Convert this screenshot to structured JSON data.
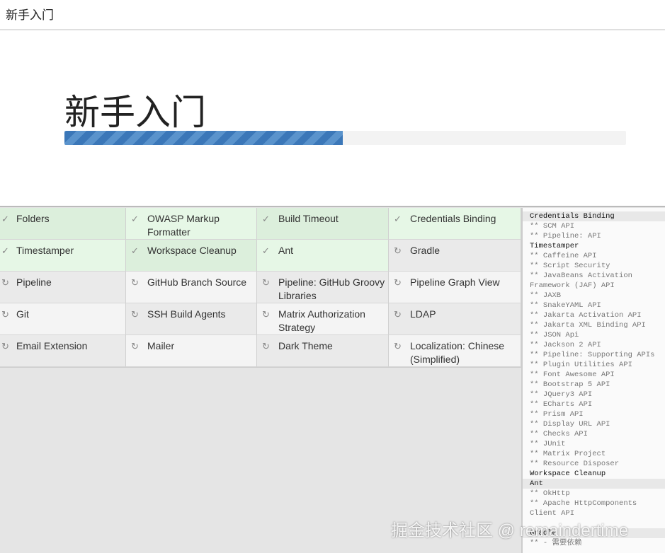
{
  "window_title": "新手入门",
  "heading": "新手入门",
  "progress_percent": 49.6,
  "plugins": [
    {
      "name": "Folders",
      "status": "installed"
    },
    {
      "name": "OWASP Markup Formatter",
      "status": "installed"
    },
    {
      "name": "Build Timeout",
      "status": "installed"
    },
    {
      "name": "Credentials Binding",
      "status": "installed"
    },
    {
      "name": "Timestamper",
      "status": "installed"
    },
    {
      "name": "Workspace Cleanup",
      "status": "installed"
    },
    {
      "name": "Ant",
      "status": "installed"
    },
    {
      "name": "Gradle",
      "status": "pending"
    },
    {
      "name": "Pipeline",
      "status": "pending"
    },
    {
      "name": "GitHub Branch Source",
      "status": "pending"
    },
    {
      "name": "Pipeline: GitHub Groovy Libraries",
      "status": "pending"
    },
    {
      "name": "Pipeline Graph View",
      "status": "pending"
    },
    {
      "name": "Git",
      "status": "pending"
    },
    {
      "name": "SSH Build Agents",
      "status": "pending"
    },
    {
      "name": "Matrix Authorization Strategy",
      "status": "pending"
    },
    {
      "name": "LDAP",
      "status": "pending"
    },
    {
      "name": "Email Extension",
      "status": "pending"
    },
    {
      "name": "Mailer",
      "status": "pending"
    },
    {
      "name": "Dark Theme",
      "status": "pending"
    },
    {
      "name": "Localization: Chinese (Simplified)",
      "status": "pending"
    }
  ],
  "log": [
    {
      "text": "Credentials Binding",
      "type": "h",
      "hl": true
    },
    {
      "text": "** SCM API"
    },
    {
      "text": "** Pipeline: API"
    },
    {
      "text": "Timestamper",
      "type": "h"
    },
    {
      "text": "** Caffeine API"
    },
    {
      "text": "** Script Security"
    },
    {
      "text": "** JavaBeans Activation Framework (JAF) API"
    },
    {
      "text": "** JAXB"
    },
    {
      "text": "** SnakeYAML API"
    },
    {
      "text": "** Jakarta Activation API"
    },
    {
      "text": "** Jakarta XML Binding API"
    },
    {
      "text": "** JSON Api"
    },
    {
      "text": "** Jackson 2 API"
    },
    {
      "text": "** Pipeline: Supporting APIs"
    },
    {
      "text": "** Plugin Utilities API"
    },
    {
      "text": "** Font Awesome API"
    },
    {
      "text": "** Bootstrap 5 API"
    },
    {
      "text": "** JQuery3 API"
    },
    {
      "text": "** ECharts API"
    },
    {
      "text": "** Prism API"
    },
    {
      "text": "** Display URL API"
    },
    {
      "text": "** Checks API"
    },
    {
      "text": "** JUnit"
    },
    {
      "text": "** Matrix Project"
    },
    {
      "text": "** Resource Disposer"
    },
    {
      "text": "Workspace Cleanup",
      "type": "h"
    },
    {
      "text": "Ant",
      "type": "h",
      "hl": true
    },
    {
      "text": "** OkHttp"
    },
    {
      "text": "** Apache HttpComponents Client API"
    },
    {
      "text": ""
    },
    {
      "text": "Gradle",
      "type": "h",
      "hl": true
    },
    {
      "text": "** - 需要依赖"
    }
  ],
  "watermark": "掘金技术社区 @ remaindertime",
  "colors": {
    "progress": "#3b77b8",
    "installed": "#dcefdc",
    "pending": "#eaeaea"
  }
}
